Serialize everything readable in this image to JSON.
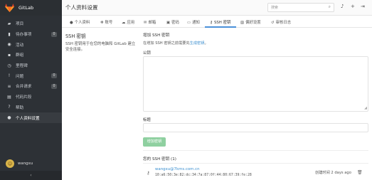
{
  "app": {
    "name": "GitLab"
  },
  "sidebar": {
    "items": [
      {
        "icon": "bookmark-icon",
        "glyph": "▰",
        "label": "项目",
        "count": null
      },
      {
        "icon": "bell-icon",
        "glyph": "▮",
        "label": "待办事项",
        "count": "0"
      },
      {
        "icon": "dashboard-icon",
        "glyph": "◉",
        "label": "活动",
        "count": null
      },
      {
        "icon": "users-icon",
        "glyph": "▪",
        "label": "群组",
        "count": null
      },
      {
        "icon": "clock-icon",
        "glyph": "◷",
        "label": "里程碑",
        "count": null
      },
      {
        "icon": "exclamation-icon",
        "glyph": "!",
        "label": "问题",
        "count": "0"
      },
      {
        "icon": "list-icon",
        "glyph": "≡",
        "label": "合并请求",
        "count": "0"
      },
      {
        "icon": "clipboard-icon",
        "glyph": "▤",
        "label": "代码片段",
        "count": null
      },
      {
        "icon": "question-icon",
        "glyph": "?",
        "label": "帮助",
        "count": null
      },
      {
        "icon": "user-icon",
        "glyph": "●",
        "label": "个人资料设置",
        "count": null,
        "active": true
      }
    ],
    "user": {
      "name": "wangxu"
    },
    "collapse_glyph": "‹"
  },
  "header": {
    "title": "个人资料设置",
    "search_placeholder": "搜索"
  },
  "tabs": [
    {
      "icon": "user-icon",
      "glyph": "●",
      "label": "个人资料"
    },
    {
      "icon": "gear-icon",
      "glyph": "✻",
      "label": "账号"
    },
    {
      "icon": "cloud-icon",
      "glyph": "☁",
      "label": "应用"
    },
    {
      "icon": "envelope-icon",
      "glyph": "✉",
      "label": "邮箱"
    },
    {
      "icon": "lock-icon",
      "glyph": "▣",
      "label": "密码"
    },
    {
      "icon": "inbox-icon",
      "glyph": "▭",
      "label": "通知"
    },
    {
      "icon": "key-icon",
      "glyph": "⚷",
      "label": "SSH 密钥",
      "active": true
    },
    {
      "icon": "image-icon",
      "glyph": "▨",
      "label": "偏好设置"
    },
    {
      "icon": "history-icon",
      "glyph": "↺",
      "label": "审核日志"
    }
  ],
  "left": {
    "title": "SSH 密钥",
    "description": "SSH 密钥用于在您的电脑和 GitLab 建立安全连接。"
  },
  "form": {
    "heading": "增加 SSH 密钥",
    "help_prefix": "在增加 SSH 密钥之前需要先",
    "help_link": "生成密钥",
    "help_suffix": "。",
    "key_label": "公钥",
    "title_label": "标题",
    "submit_label": "增加密钥"
  },
  "keys": {
    "heading": "您的 SSH 密钥 (1)",
    "items": [
      {
        "name": "wangxu@7kms.com.cn",
        "fingerprint": "10:a6:50:3e:82:dc:34:7a:87:0f:44:80:67:39:fe:28",
        "created": "创建时间 2 days ago"
      }
    ]
  },
  "colors": {
    "sidebar_bg": "#2d3136",
    "accent": "#3b8fd0",
    "button_green": "#8fd0a0"
  }
}
